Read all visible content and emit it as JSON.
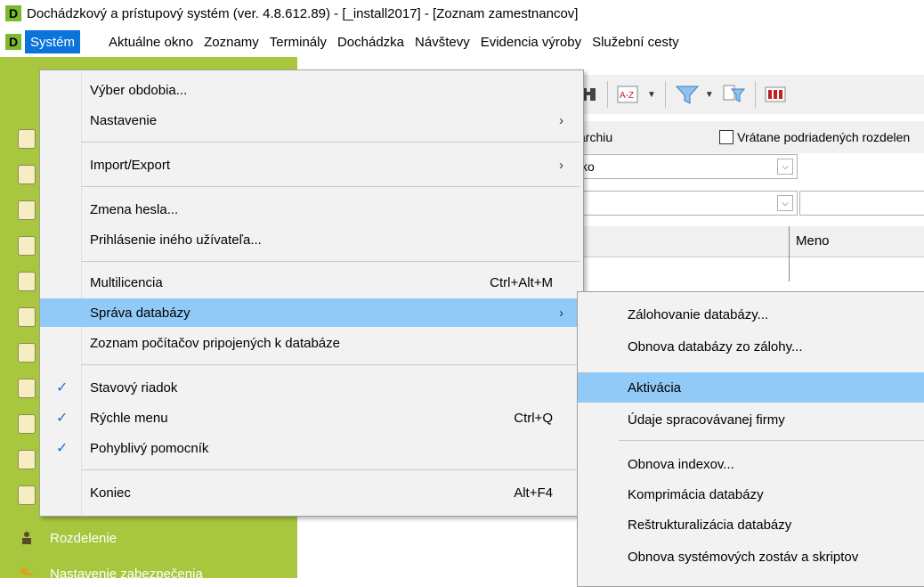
{
  "window": {
    "title": "Dochádzkový a prístupový systém (ver. 4.8.612.89) - [_install2017] - [Zoznam zamestnancov]",
    "logo_letter": "D"
  },
  "menubar": {
    "items": [
      {
        "label": "Systém"
      },
      {
        "label": "Aktuálne okno"
      },
      {
        "label": "Zoznamy"
      },
      {
        "label": "Terminály"
      },
      {
        "label": "Dochádzka"
      },
      {
        "label": "Návštevy"
      },
      {
        "label": "Evidencia výroby"
      },
      {
        "label": "Služební cesty"
      }
    ]
  },
  "background": {
    "filter_left": "archiu",
    "checkbox_label": "Vrátane podriadených rozdelen",
    "combo1_value": "ko",
    "grid_col_label": "Meno",
    "sidebar_labels": [
      "Rozdelenie",
      "Nastavenie zabezpečenia"
    ]
  },
  "system_menu": {
    "items": [
      {
        "label": "Výber obdobia...",
        "shortcut": "",
        "submenu": false,
        "checked": false
      },
      {
        "label": "Nastavenie",
        "shortcut": "",
        "submenu": true,
        "checked": false
      },
      {
        "label": "Import/Export",
        "shortcut": "",
        "submenu": true,
        "checked": false
      },
      {
        "label": "Zmena hesla...",
        "shortcut": "",
        "submenu": false,
        "checked": false
      },
      {
        "label": "Prihlásenie iného užívateľa...",
        "shortcut": "",
        "submenu": false,
        "checked": false
      },
      {
        "label": "Multilicencia",
        "shortcut": "Ctrl+Alt+M",
        "submenu": false,
        "checked": false
      },
      {
        "label": "Správa databázy",
        "shortcut": "",
        "submenu": true,
        "checked": false,
        "highlighted": true
      },
      {
        "label": "Zoznam počítačov pripojených k databáze",
        "shortcut": "",
        "submenu": false,
        "checked": false
      },
      {
        "label": "Stavový riadok",
        "shortcut": "",
        "submenu": false,
        "checked": true
      },
      {
        "label": "Rýchle menu",
        "shortcut": "Ctrl+Q",
        "submenu": false,
        "checked": true
      },
      {
        "label": "Pohyblivý pomocník",
        "shortcut": "",
        "submenu": false,
        "checked": true
      },
      {
        "label": "Koniec",
        "shortcut": "Alt+F4",
        "submenu": false,
        "checked": false
      }
    ]
  },
  "database_submenu": {
    "items": [
      {
        "label": "Zálohovanie databázy..."
      },
      {
        "label": "Obnova databázy zo zálohy..."
      },
      {
        "label": "Aktivácia",
        "highlighted": true
      },
      {
        "label": "Údaje spracovávanej firmy"
      },
      {
        "label": "Obnova indexov..."
      },
      {
        "label": "Komprimácia databázy"
      },
      {
        "label": "Reštrukturalizácia databázy"
      },
      {
        "label": "Obnova systémových zostáv a skriptov"
      }
    ]
  },
  "icons": {
    "checkmark": "✓",
    "submenu_arrow": "›",
    "combo_arrow": "⌵"
  },
  "colors": {
    "sidebar": "#a9c63f",
    "highlight": "#91c9f7",
    "menubar_active": "#0a74da",
    "logo": "#7db92f"
  }
}
